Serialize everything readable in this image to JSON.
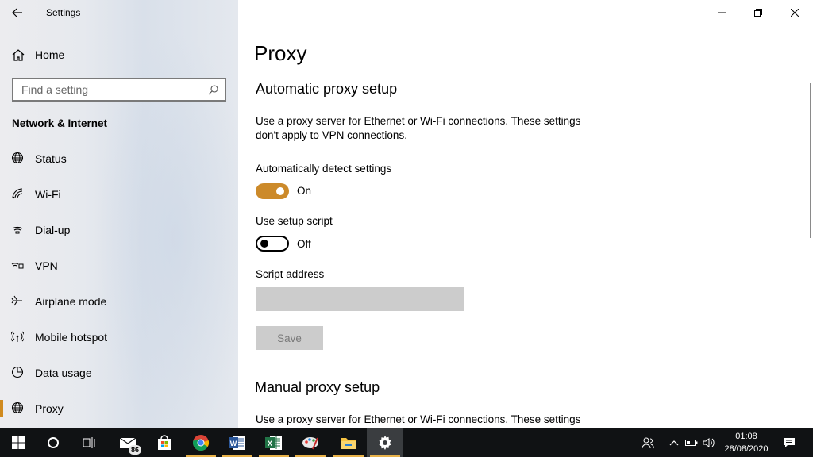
{
  "window": {
    "app_title": "Settings"
  },
  "sidebar": {
    "home_label": "Home",
    "search_placeholder": "Find a setting",
    "section_heading": "Network & Internet",
    "items": [
      {
        "label": "Status",
        "icon": "globe-icon"
      },
      {
        "label": "Wi-Fi",
        "icon": "wifi-icon"
      },
      {
        "label": "Dial-up",
        "icon": "dialup-icon"
      },
      {
        "label": "VPN",
        "icon": "vpn-icon"
      },
      {
        "label": "Airplane mode",
        "icon": "airplane-icon"
      },
      {
        "label": "Mobile hotspot",
        "icon": "hotspot-icon"
      },
      {
        "label": "Data usage",
        "icon": "data-usage-icon"
      },
      {
        "label": "Proxy",
        "icon": "globe-icon",
        "active": true
      }
    ]
  },
  "main": {
    "page_title": "Proxy",
    "auto_setup": {
      "heading": "Automatic proxy setup",
      "description": "Use a proxy server for Ethernet or Wi-Fi connections. These settings don't apply to VPN connections.",
      "detect_label": "Automatically detect settings",
      "detect_state": "On",
      "script_label": "Use setup script",
      "script_state": "Off",
      "address_label": "Script address",
      "address_value": "",
      "save_label": "Save"
    },
    "manual_setup": {
      "heading": "Manual proxy setup",
      "description": "Use a proxy server for Ethernet or Wi-Fi connections. These settings"
    }
  },
  "taskbar": {
    "mail_badge": "86",
    "time": "01:08",
    "date": "28/08/2020"
  },
  "colors": {
    "accent": "#cc8a2a",
    "taskbar": "#101214"
  }
}
